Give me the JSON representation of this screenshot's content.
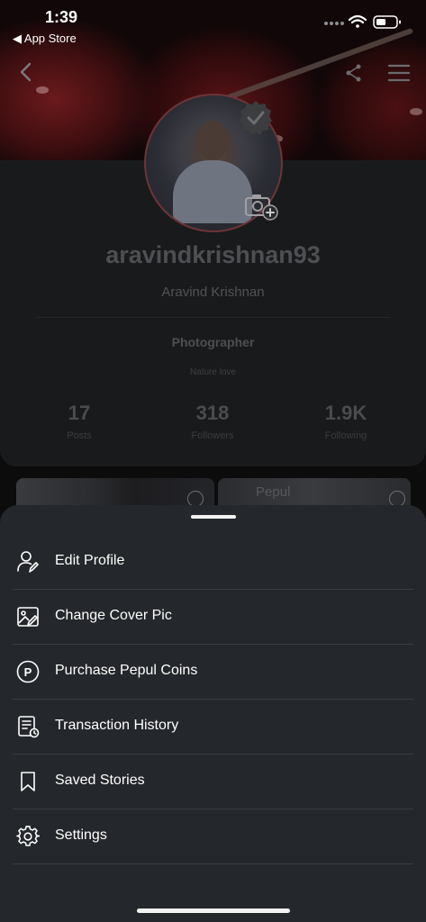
{
  "status_bar": {
    "time": "1:39",
    "back_app": "◀ App Store"
  },
  "profile": {
    "username": "aravindkrishnan93",
    "full_name": "Aravind Krishnan",
    "role": "Photographer",
    "bio": "Nature love",
    "stats": [
      {
        "value": "17",
        "label": "Posts"
      },
      {
        "value": "318",
        "label": "Followers"
      },
      {
        "value": "1.9K",
        "label": "Following"
      }
    ]
  },
  "thumbnails": {
    "watermark": "Pepul"
  },
  "menu": {
    "items": [
      {
        "label": "Edit Profile",
        "icon": "edit-profile-icon"
      },
      {
        "label": "Change Cover Pic",
        "icon": "image-edit-icon"
      },
      {
        "label": "Purchase Pepul Coins",
        "icon": "pepul-coin-icon"
      },
      {
        "label": "Transaction History",
        "icon": "transaction-history-icon"
      },
      {
        "label": "Saved Stories",
        "icon": "bookmark-icon"
      },
      {
        "label": "Settings",
        "icon": "gear-icon"
      }
    ]
  },
  "colors": {
    "sheet_background": "#24272b",
    "profile_panel": "#191a1c",
    "accent_red": "#6e3438"
  }
}
